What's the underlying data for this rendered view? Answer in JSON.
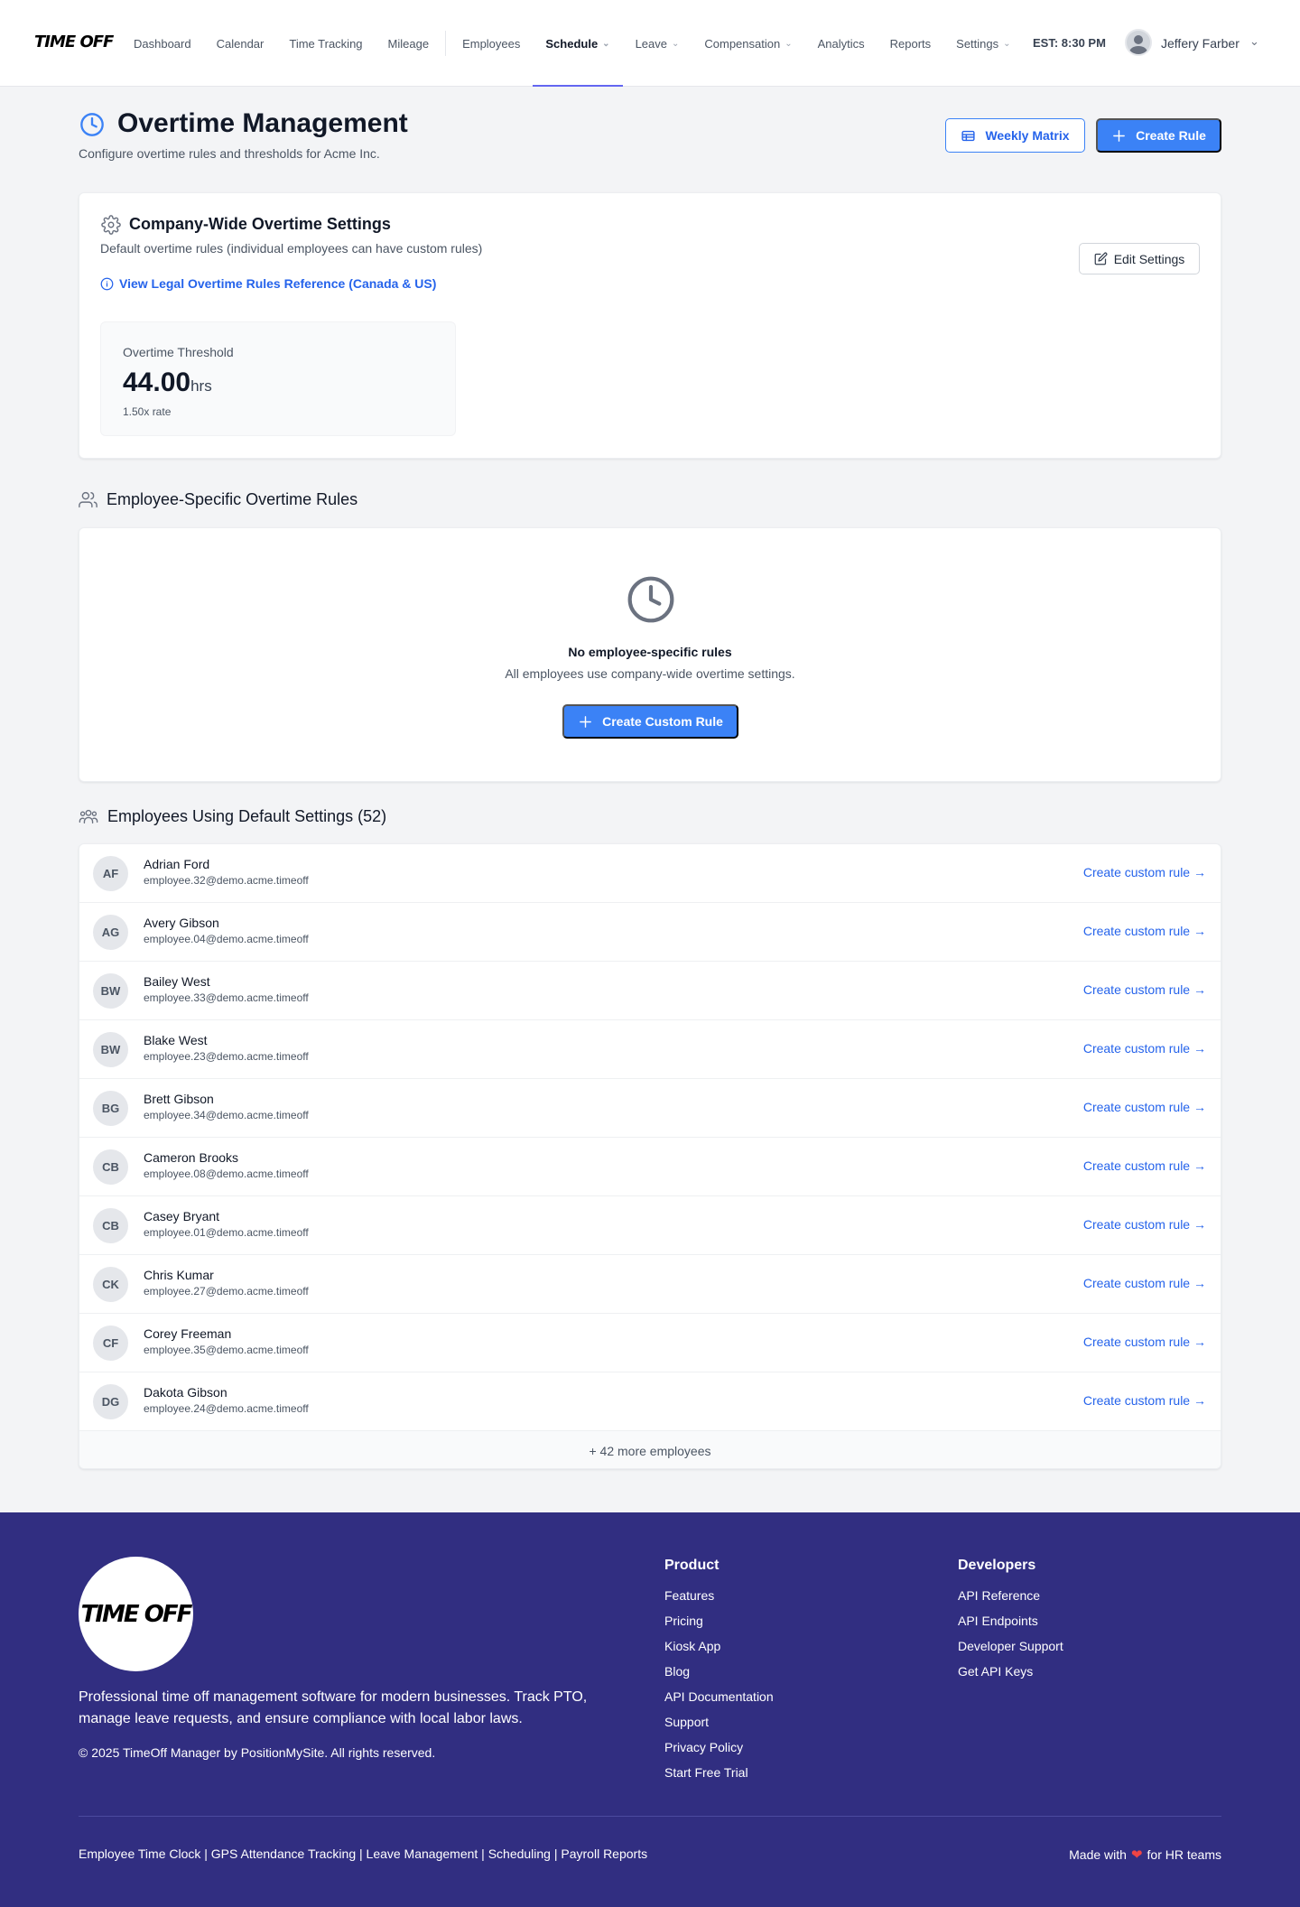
{
  "brand": {
    "logo_text": "TIME OFF"
  },
  "nav": {
    "items": [
      {
        "label": "Dashboard",
        "dropdown": false,
        "active": false
      },
      {
        "label": "Calendar",
        "dropdown": false,
        "active": false
      },
      {
        "label": "Time Tracking",
        "dropdown": false,
        "active": false
      },
      {
        "label": "Mileage",
        "dropdown": false,
        "active": false
      },
      {
        "label": "Employees",
        "dropdown": false,
        "active": false
      },
      {
        "label": "Schedule",
        "dropdown": true,
        "active": true
      },
      {
        "label": "Leave",
        "dropdown": true,
        "active": false
      },
      {
        "label": "Compensation",
        "dropdown": true,
        "active": false
      },
      {
        "label": "Analytics",
        "dropdown": false,
        "active": false
      },
      {
        "label": "Reports",
        "dropdown": false,
        "active": false
      },
      {
        "label": "Settings",
        "dropdown": true,
        "active": false
      }
    ],
    "clock": "EST: 8:30 PM",
    "user_name": "Jeffery Farber"
  },
  "header": {
    "title": "Overtime Management",
    "subtitle": "Configure overtime rules and thresholds for Acme Inc.",
    "weekly_matrix_label": "Weekly Matrix",
    "create_rule_label": "Create Rule"
  },
  "company_settings": {
    "title": "Company-Wide Overtime Settings",
    "subtitle": "Default overtime rules (individual employees can have custom rules)",
    "legal_link": "View Legal Overtime Rules Reference (Canada & US)",
    "edit_label": "Edit Settings",
    "threshold_label": "Overtime Threshold",
    "threshold_value": "44.00",
    "threshold_unit": "hrs",
    "threshold_rate": "1.50x rate"
  },
  "employee_rules": {
    "title": "Employee-Specific Overtime Rules",
    "empty_title": "No employee-specific rules",
    "empty_subtitle": "All employees use company-wide overtime settings.",
    "create_custom_label": "Create Custom Rule"
  },
  "default_employees": {
    "title": "Employees Using Default Settings (52)",
    "link_label": "Create custom rule →",
    "rows": [
      {
        "initials": "AF",
        "name": "Adrian Ford",
        "email": "employee.32@demo.acme.timeoff"
      },
      {
        "initials": "AG",
        "name": "Avery Gibson",
        "email": "employee.04@demo.acme.timeoff"
      },
      {
        "initials": "BW",
        "name": "Bailey West",
        "email": "employee.33@demo.acme.timeoff"
      },
      {
        "initials": "BW",
        "name": "Blake West",
        "email": "employee.23@demo.acme.timeoff"
      },
      {
        "initials": "BG",
        "name": "Brett Gibson",
        "email": "employee.34@demo.acme.timeoff"
      },
      {
        "initials": "CB",
        "name": "Cameron Brooks",
        "email": "employee.08@demo.acme.timeoff"
      },
      {
        "initials": "CB",
        "name": "Casey Bryant",
        "email": "employee.01@demo.acme.timeoff"
      },
      {
        "initials": "CK",
        "name": "Chris Kumar",
        "email": "employee.27@demo.acme.timeoff"
      },
      {
        "initials": "CF",
        "name": "Corey Freeman",
        "email": "employee.35@demo.acme.timeoff"
      },
      {
        "initials": "DG",
        "name": "Dakota Gibson",
        "email": "employee.24@demo.acme.timeoff"
      }
    ],
    "more_label": "+ 42 more employees"
  },
  "footer": {
    "logo_text": "TIME OFF",
    "description": "Professional time off management software for modern businesses. Track PTO, manage leave requests, and ensure compliance with local labor laws.",
    "copyright": "© 2025 TimeOff Manager by PositionMySite. All rights reserved.",
    "product_title": "Product",
    "product_links": [
      "Features",
      "Pricing",
      "Kiosk App",
      "Blog",
      "API Documentation",
      "Support",
      "Privacy Policy",
      "Start Free Trial"
    ],
    "developers_title": "Developers",
    "developer_links": [
      "API Reference",
      "API Endpoints",
      "Developer Support",
      "Get API Keys"
    ],
    "bottom_links": "Employee Time Clock | GPS Attendance Tracking | Leave Management | Scheduling | Payroll Reports",
    "made_with_prefix": "Made with",
    "made_with_suffix": "for HR teams"
  },
  "colors": {
    "accent": "#3b82f6",
    "link": "#2563eb",
    "footer_bg": "#312e81",
    "nav_active_underline": "#6366f1"
  },
  "icons": {
    "page": "clock-icon",
    "settings": "gear-icon",
    "legal": "info-icon",
    "edit": "edit-icon",
    "rules": "users-icon",
    "empty": "clock-icon",
    "employees": "team-icon",
    "weekly_matrix": "table-icon",
    "create": "plus-icon",
    "heart": "heart-icon"
  }
}
